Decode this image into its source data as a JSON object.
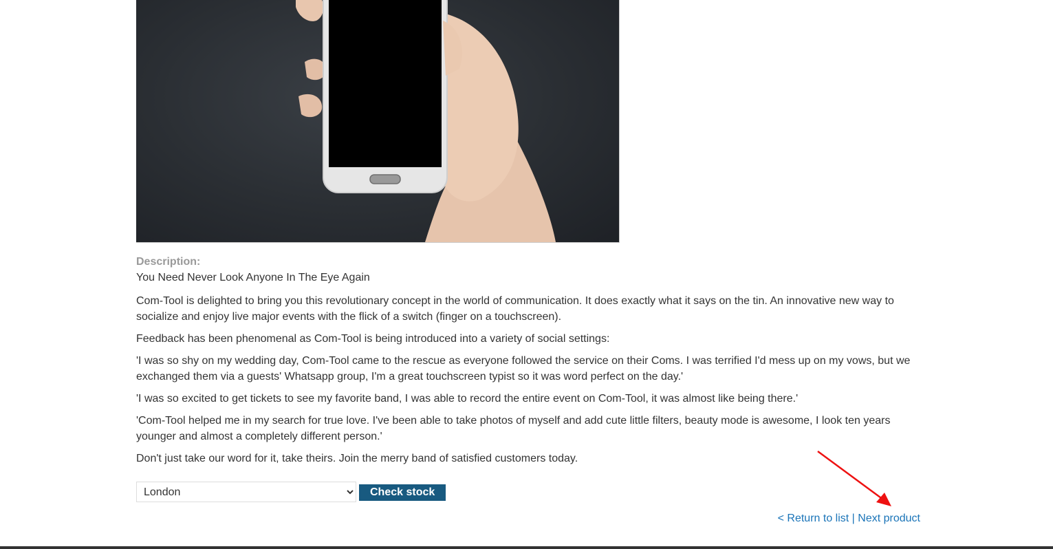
{
  "description": {
    "label": "Description:",
    "headline": "You Need Never Look Anyone In The Eye Again",
    "paragraphs": [
      "Com-Tool is delighted to bring you this revolutionary concept in the world of communication. It does exactly what it says on the tin. An innovative new way to socialize and enjoy live major events with the flick of a switch (finger on a touchscreen).",
      "Feedback has been phenomenal as Com-Tool is being introduced into a variety of social settings:",
      "'I was so shy on my wedding day, Com-Tool came to the rescue as everyone followed the service on their Coms. I was terrified I'd mess up on my vows, but we exchanged them via a guests' Whatsapp group, I'm a great touchscreen typist so it was word perfect on the day.'",
      "'I was so excited to get tickets to see my favorite band, I was able to record the entire event on Com-Tool, it was almost like being there.'",
      "'Com-Tool helped me in my search for true love. I've been able to take photos of myself and add cute little filters, beauty mode is awesome, I look ten years younger and almost a completely different person.'",
      "Don't just take our word for it, take theirs. Join the merry band of satisfied customers today."
    ]
  },
  "stock_check": {
    "selected_store": "London",
    "button_label": "Check stock"
  },
  "navigation": {
    "return_label": "< Return to list",
    "separator": "|",
    "next_label": "Next product"
  },
  "image": {
    "icon": "hand-holding-phone"
  },
  "colors": {
    "button_bg": "#185a80",
    "link": "#1a74b8",
    "arrow": "#ee1111"
  }
}
